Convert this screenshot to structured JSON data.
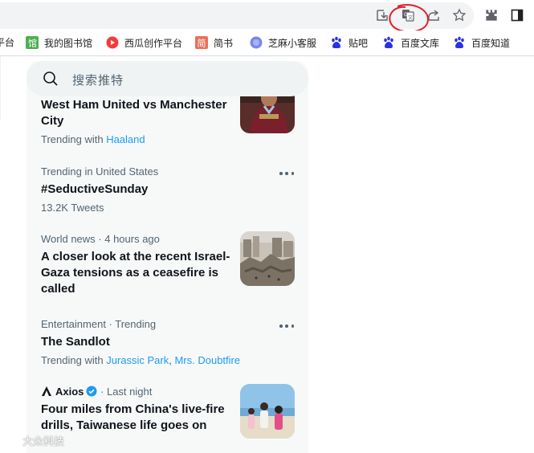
{
  "bookmarks": [
    {
      "label": "平台",
      "icon": "generic-icon"
    },
    {
      "label": "我的图书馆",
      "icon": "library-icon"
    },
    {
      "label": "西瓜创作平台",
      "icon": "xigua-icon"
    },
    {
      "label": "简书",
      "icon": "jianshu-icon"
    },
    {
      "label": "芝麻小客服",
      "icon": "zhima-icon"
    },
    {
      "label": "贴吧",
      "icon": "baidu-paw-icon"
    },
    {
      "label": "百度文库",
      "icon": "baidu-paw-icon"
    },
    {
      "label": "百度知道",
      "icon": "baidu-paw-icon"
    }
  ],
  "search": {
    "placeholder": "搜索推特"
  },
  "trends": [
    {
      "title_line1": "West Ham United vs Manchester",
      "title_line2": "City",
      "sub_prefix": "Trending with",
      "sub_links": [
        "Haaland"
      ],
      "thumb": "football-player-photo"
    },
    {
      "meta": "Trending in United States",
      "title": "#SeductiveSunday",
      "sub": "13.2K Tweets"
    },
    {
      "meta": "World news · 4 hours ago",
      "title_lines": [
        "A closer look at the recent Israel-",
        "Gaza tensions as a ceasefire is",
        "called"
      ],
      "thumb": "destroyed-buildings-photo"
    },
    {
      "meta": "Entertainment · Trending",
      "title": "The Sandlot",
      "sub_prefix": "Trending with",
      "sub_links": [
        "Jurassic Park",
        "Mrs. Doubtfire"
      ],
      "sub_separator": ","
    },
    {
      "source": "Axios",
      "meta_suffix": "· Last night",
      "title_lines": [
        "Four miles from China's live-fire",
        "drills, Taiwanese life goes on"
      ],
      "thumb": "beach-people-photo"
    }
  ],
  "watermark": "大众科技",
  "colors": {
    "accent": "#1d9bf0",
    "panel_bg": "#f7f9f9",
    "search_bg": "#eff3f4",
    "annotation": "#e0202a"
  }
}
